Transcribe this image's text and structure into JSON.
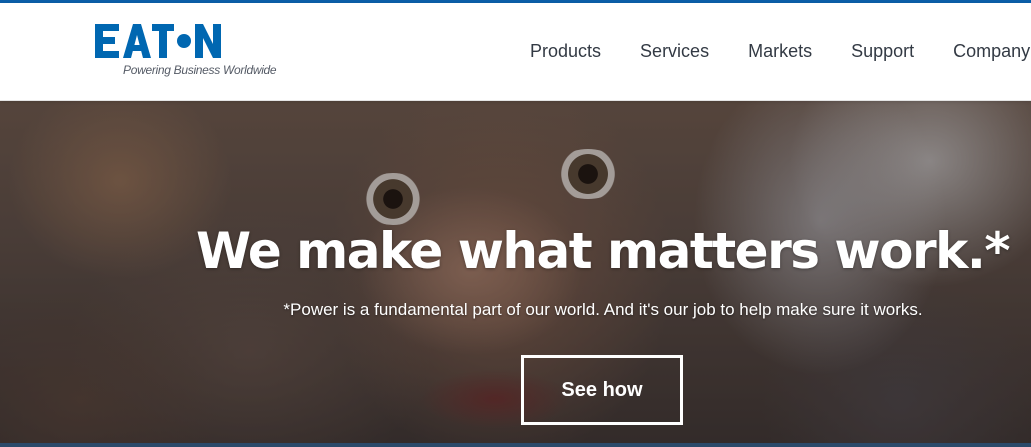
{
  "colors": {
    "brand_blue": "#0067b1",
    "top_stripe": "#0b5ea8",
    "nav_text": "#333a44",
    "hero_text": "#ffffff"
  },
  "header": {
    "logo": {
      "wordmark": "EATON",
      "tagline": "Powering Business Worldwide"
    },
    "nav": [
      {
        "label": "Products"
      },
      {
        "label": "Services"
      },
      {
        "label": "Markets"
      },
      {
        "label": "Support"
      },
      {
        "label": "Company"
      }
    ]
  },
  "hero": {
    "headline": "We make what matters work.*",
    "subline": "*Power is a fundamental part of our world. And it's our job to help make sure it works.",
    "cta_label": "See how"
  }
}
